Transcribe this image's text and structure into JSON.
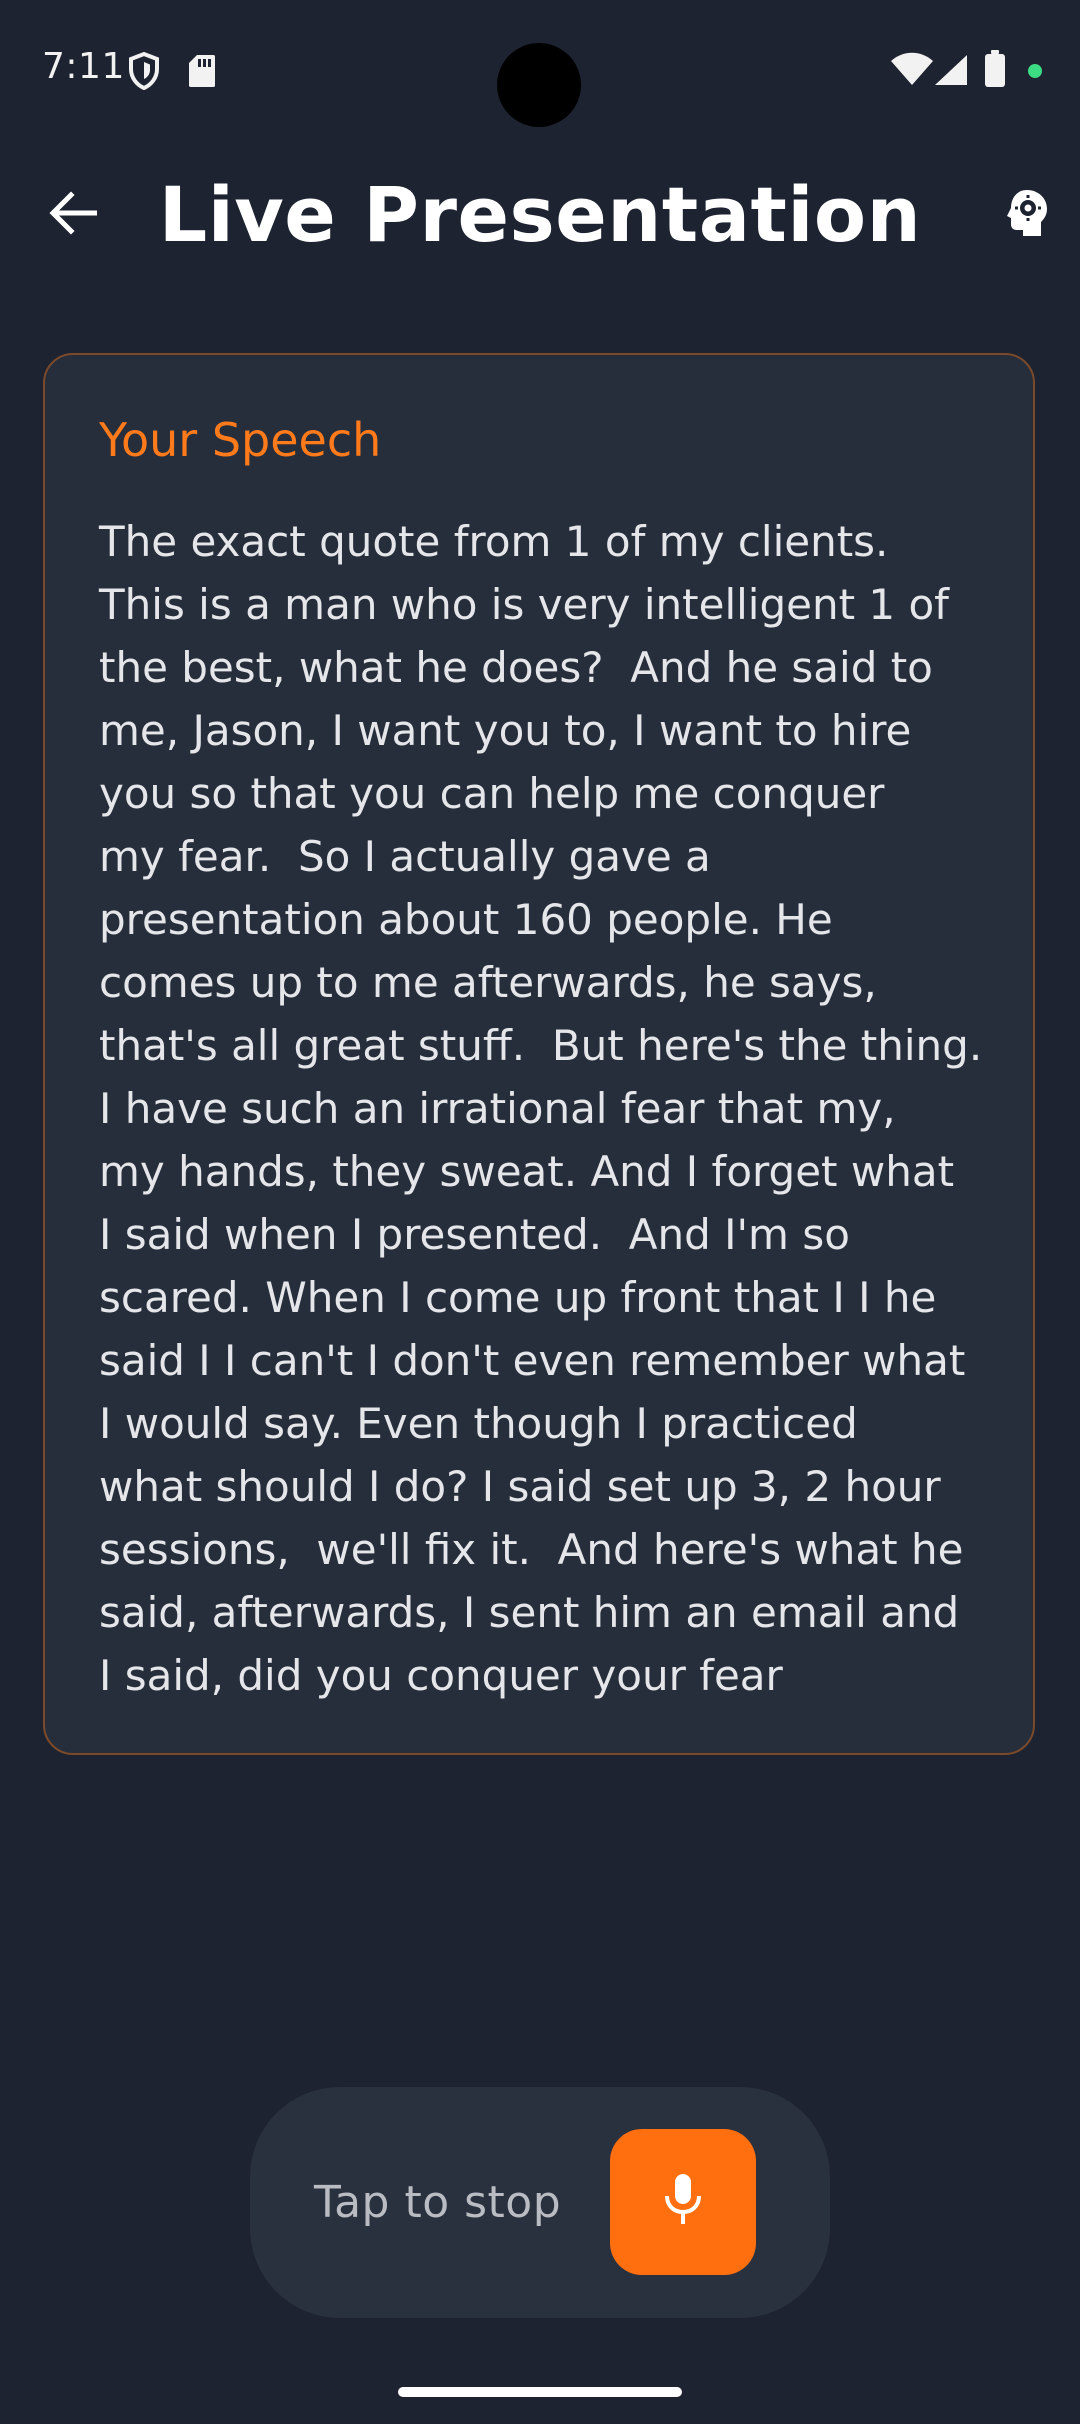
{
  "status_bar": {
    "time": "7:11",
    "icons": [
      "shield-icon",
      "sd-card-icon",
      "wifi-icon",
      "signal-icon",
      "battery-icon",
      "privacy-dot"
    ],
    "privacy_dot_color": "#3ddc84"
  },
  "app_bar": {
    "title": "Live Presentation",
    "back_icon": "arrow-back-icon",
    "settings_icon": "head-gear-icon"
  },
  "speech_card": {
    "heading": "Your Speech",
    "text": "The exact quote from 1 of my clients.\nThis is a man who is very intelligent 1 of\nthe best, what he does?  And he said to\nme, Jason, I want you to, I want to hire\nyou so that you can help me conquer\nmy fear.  So I actually gave a\npresentation about 160 people. He\ncomes up to me afterwards, he says,\nthat's all great stuff.  But here's the thing.\nI have such an irrational fear that my,\nmy hands, they sweat. And I forget what\nI said when I presented.  And I'm so\nscared. When I come up front that I I he\nsaid I I can't I don't even remember what\nI would say. Even though I practiced\nwhat should I do? I said set up 3, 2 hour\nsessions,  we'll fix it.  And here's what he\nsaid, afterwards, I sent him an email and\nI said, did you conquer your fear"
  },
  "record_control": {
    "label": "Tap to stop",
    "mic_icon": "microphone-icon",
    "accent_color": "#ff6f0f"
  },
  "colors": {
    "background": "#1d2330",
    "card_background": "#272e3b",
    "card_border": "#7a4a2a",
    "heading_accent": "#ff7a1a"
  }
}
